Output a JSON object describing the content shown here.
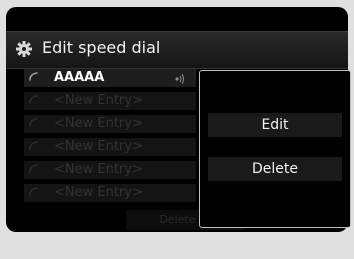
{
  "header": {
    "title": "Edit speed dial",
    "icon": "gear-icon"
  },
  "entries": [
    {
      "label": "AAAAA",
      "state": "filled",
      "icon": "phone-handset-icon",
      "voice_tag": "voice-tag-icon"
    },
    {
      "label": "<New Entry>",
      "state": "empty",
      "icon": "phone-handset-icon"
    },
    {
      "label": "<New Entry>",
      "state": "empty",
      "icon": "phone-handset-icon"
    },
    {
      "label": "<New Entry>",
      "state": "empty",
      "icon": "phone-handset-icon"
    },
    {
      "label": "<New Entry>",
      "state": "empty",
      "icon": "phone-handset-icon"
    },
    {
      "label": "<New Entry>",
      "state": "empty",
      "icon": "phone-handset-icon"
    }
  ],
  "footer": {
    "delete_all_label": "Delete All"
  },
  "popup_menu": {
    "items": [
      {
        "label": "Edit"
      },
      {
        "label": "Delete"
      }
    ]
  },
  "colors": {
    "background": "#000000",
    "surround": "#e0e0e0",
    "popup_border": "#bfbfbf",
    "text": "#f2f2f2",
    "disabled_text": "#333333"
  }
}
